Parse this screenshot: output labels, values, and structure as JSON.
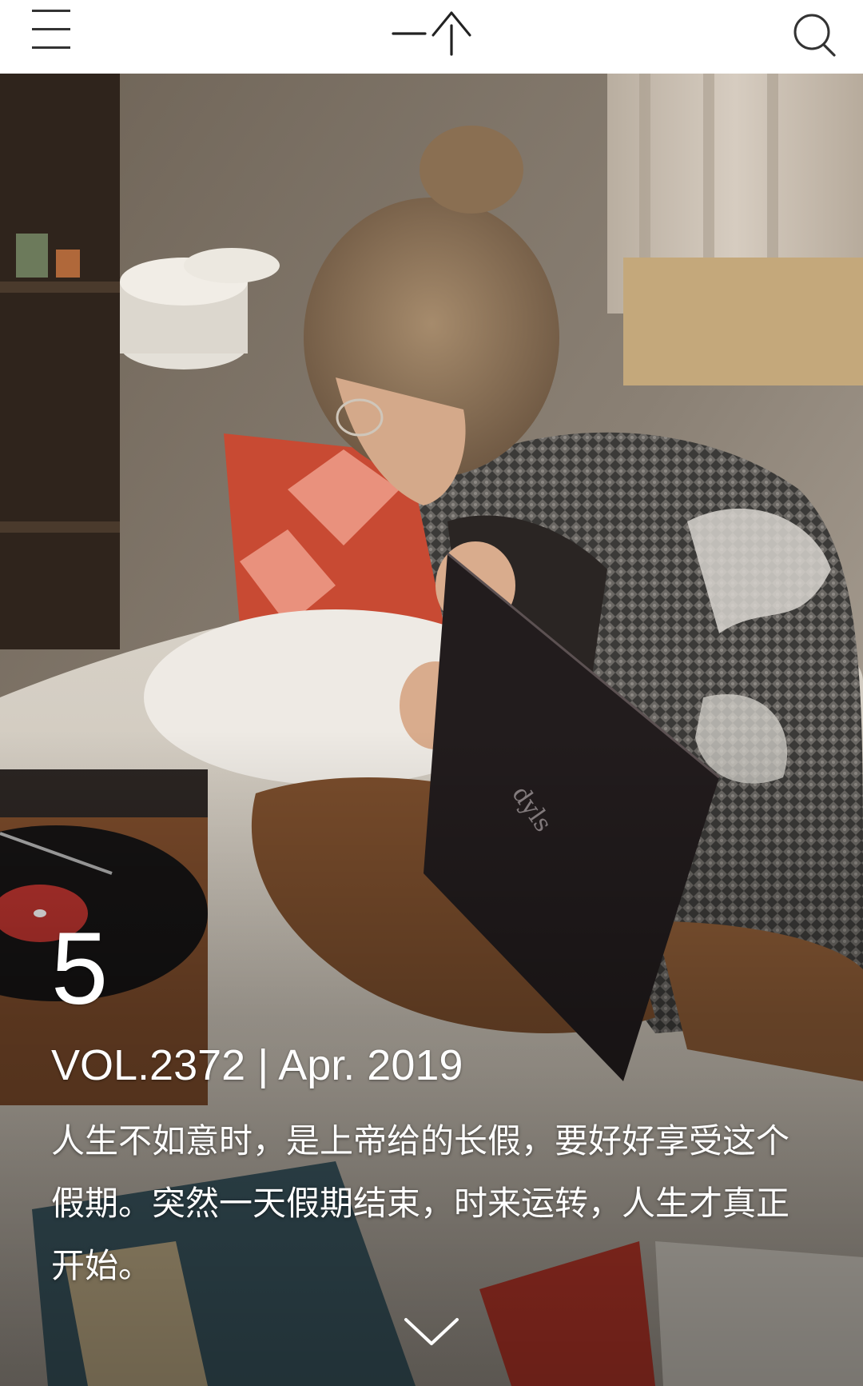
{
  "header": {
    "logo_text": "一个",
    "menu_icon": "hamburger-menu-icon",
    "search_icon": "search-icon"
  },
  "hero": {
    "image_description_icon": "photo-woman-vinyl-record"
  },
  "card": {
    "day": "5",
    "vol_date": "VOL.2372 | Apr. 2019",
    "quote": "人生不如意时，是上帝给的长假，要好好享受这个假期。突然一天假期结束，时来运转，人生才真正开始。"
  },
  "footer": {
    "more_icon": "chevron-down-icon"
  },
  "colors": {
    "header_bg": "#ffffff",
    "icon_color": "#333333",
    "text_on_image": "#ffffff"
  }
}
